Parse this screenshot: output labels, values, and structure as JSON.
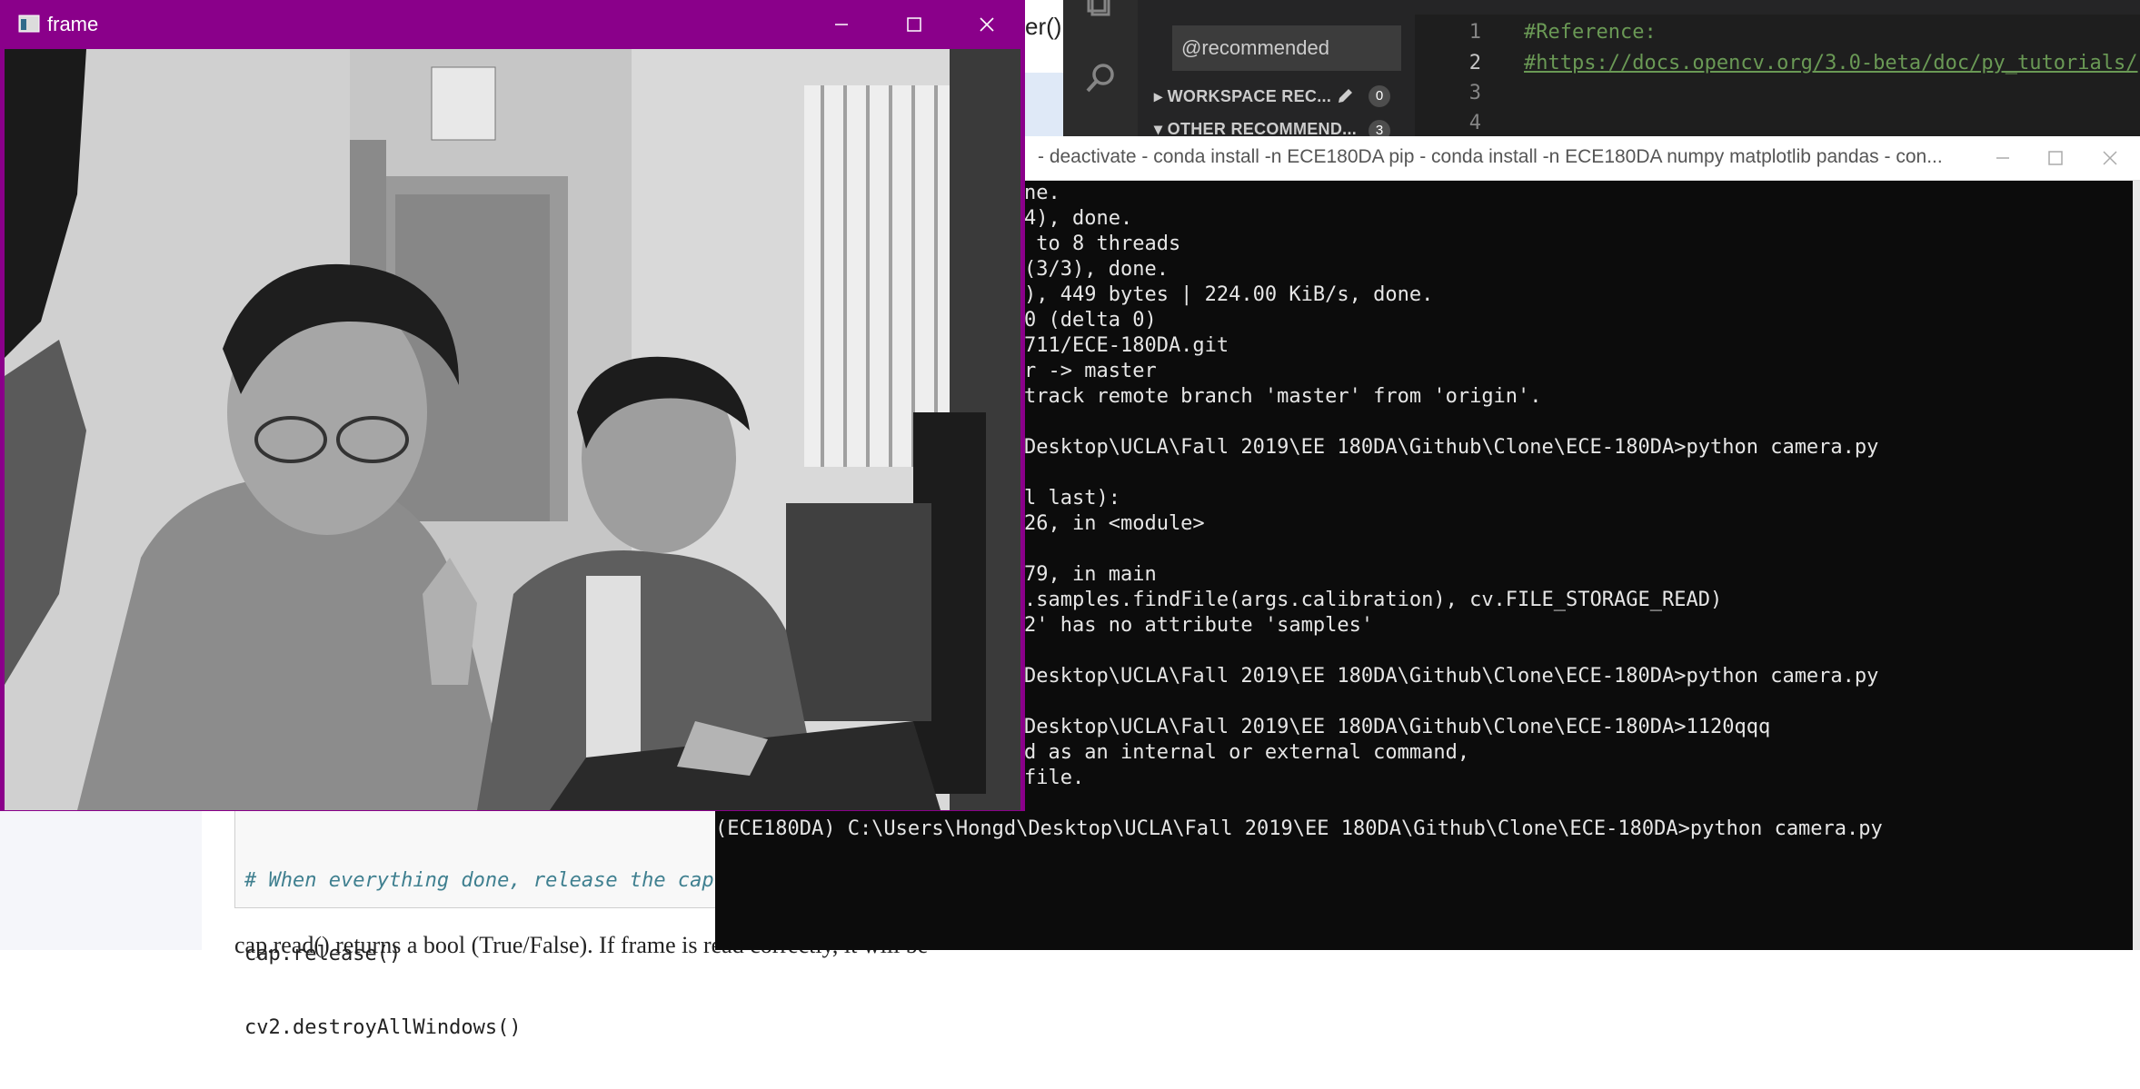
{
  "doc": {
    "fragment_top": "er()",
    "code_lines": [
      {
        "text": "# When everything done, release the captu",
        "comment": true
      },
      {
        "text": "cap.release()",
        "comment": false
      },
      {
        "text": "cv2.destroyAllWindows()",
        "comment": false
      }
    ],
    "para_text": "cap.read() returns a bool (True/False). If frame is read correctly, it will be"
  },
  "vscode": {
    "search_value": "@recommended",
    "sections": [
      {
        "label": "WORKSPACE REC...",
        "count": "0"
      },
      {
        "label": "OTHER RECOMMEND...",
        "count": "3"
      }
    ],
    "editor_lines": [
      {
        "num": "1",
        "text": "#Reference:"
      },
      {
        "num": "2",
        "text": "#https://docs.opencv.org/3.0-beta/doc/py_tutorials/"
      },
      {
        "num": "3",
        "text": ""
      },
      {
        "num": "4",
        "text": ""
      }
    ]
  },
  "terminal": {
    "title": "- deactivate - conda  install -n ECE180DA pip - conda  install -n ECE180DA numpy matplotlib pandas - con...",
    "lines": [
      "ne.",
      "4), done.",
      " to 8 threads",
      "(3/3), done.",
      "), 449 bytes | 224.00 KiB/s, done.",
      "0 (delta 0)",
      "711/ECE-180DA.git",
      "r -> master",
      "track remote branch 'master' from 'origin'.",
      "",
      "Desktop\\UCLA\\Fall 2019\\EE 180DA\\Github\\Clone\\ECE-180DA>python camera.py",
      "",
      "l last):",
      "26, in <module>",
      "",
      "79, in main",
      ".samples.findFile(args.calibration), cv.FILE_STORAGE_READ)",
      "2' has no attribute 'samples'",
      "",
      "Desktop\\UCLA\\Fall 2019\\EE 180DA\\Github\\Clone\\ECE-180DA>python camera.py",
      "",
      "Desktop\\UCLA\\Fall 2019\\EE 180DA\\Github\\Clone\\ECE-180DA>1120qqq",
      "d as an internal or external command,",
      "file."
    ],
    "prompt_line": "(ECE180DA) C:\\Users\\Hongd\\Desktop\\UCLA\\Fall 2019\\EE 180DA\\Github\\Clone\\ECE-180DA>python camera.py"
  },
  "frame_window": {
    "title": "frame",
    "image_description_icon": "grayscale-webcam-feed",
    "accent_color": "#8a008a"
  },
  "colors": {
    "terminal_bg": "#0c0c0c",
    "terminal_fg": "#e6e6e6",
    "vscode_bg": "#1e1e1e",
    "vscode_comment": "#6a9955",
    "frame_titlebar": "#8a008a"
  }
}
